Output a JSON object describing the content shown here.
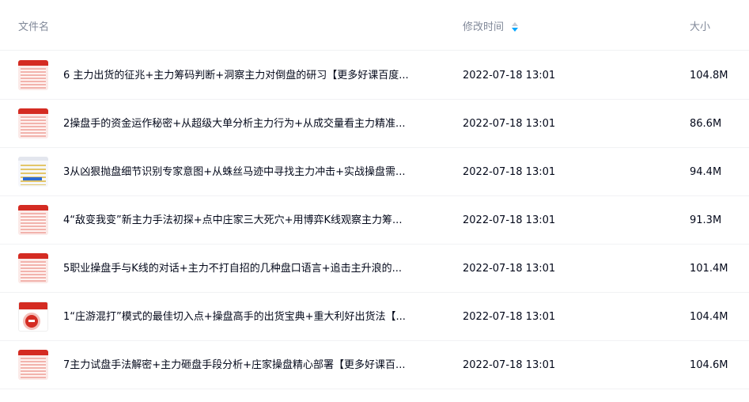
{
  "header": {
    "name_label": "文件名",
    "time_label": "修改时间",
    "size_label": "大小"
  },
  "colors": {
    "text": "#03081a",
    "header_text": "#818999",
    "sort_active": "#06a7ff",
    "divider": "#f1f2f4"
  },
  "files": [
    {
      "name": "6 主力出货的征兆+主力筹码判断+洞察主力对倒盘的研习【更多好课百度...",
      "time": "2022-07-18 13:01",
      "size": "104.8M",
      "thumb": "doc-red-icon"
    },
    {
      "name": "2操盘手的资金运作秘密+从超级大单分析主力行为+从成交量看主力精准...",
      "time": "2022-07-18 13:01",
      "size": "86.6M",
      "thumb": "doc-red-icon"
    },
    {
      "name": "3从凶狠抛盘细节识别专家意图+从蛛丝马迹中寻找主力冲击+实战操盘需...",
      "time": "2022-07-18 13:01",
      "size": "94.4M",
      "thumb": "doc-chart-icon"
    },
    {
      "name": "4“敌变我变”新主力手法初探+点中庄家三大死穴+用博弈K线观察主力筹...",
      "time": "2022-07-18 13:01",
      "size": "91.3M",
      "thumb": "doc-red-icon"
    },
    {
      "name": "5职业操盘手与K线的对话+主力不打自招的几种盘口语言+追击主升浪的...",
      "time": "2022-07-18 13:01",
      "size": "101.4M",
      "thumb": "doc-red-icon"
    },
    {
      "name": "1“庄游混打”模式的最佳切入点+操盘高手的出货宝典+重大利好出货法【...",
      "time": "2022-07-18 13:01",
      "size": "104.4M",
      "thumb": "slide-circle-icon"
    },
    {
      "name": "7主力试盘手法解密+主力砸盘手段分析+庄家操盘精心部署【更多好课百...",
      "time": "2022-07-18 13:01",
      "size": "104.6M",
      "thumb": "doc-red-icon"
    }
  ]
}
